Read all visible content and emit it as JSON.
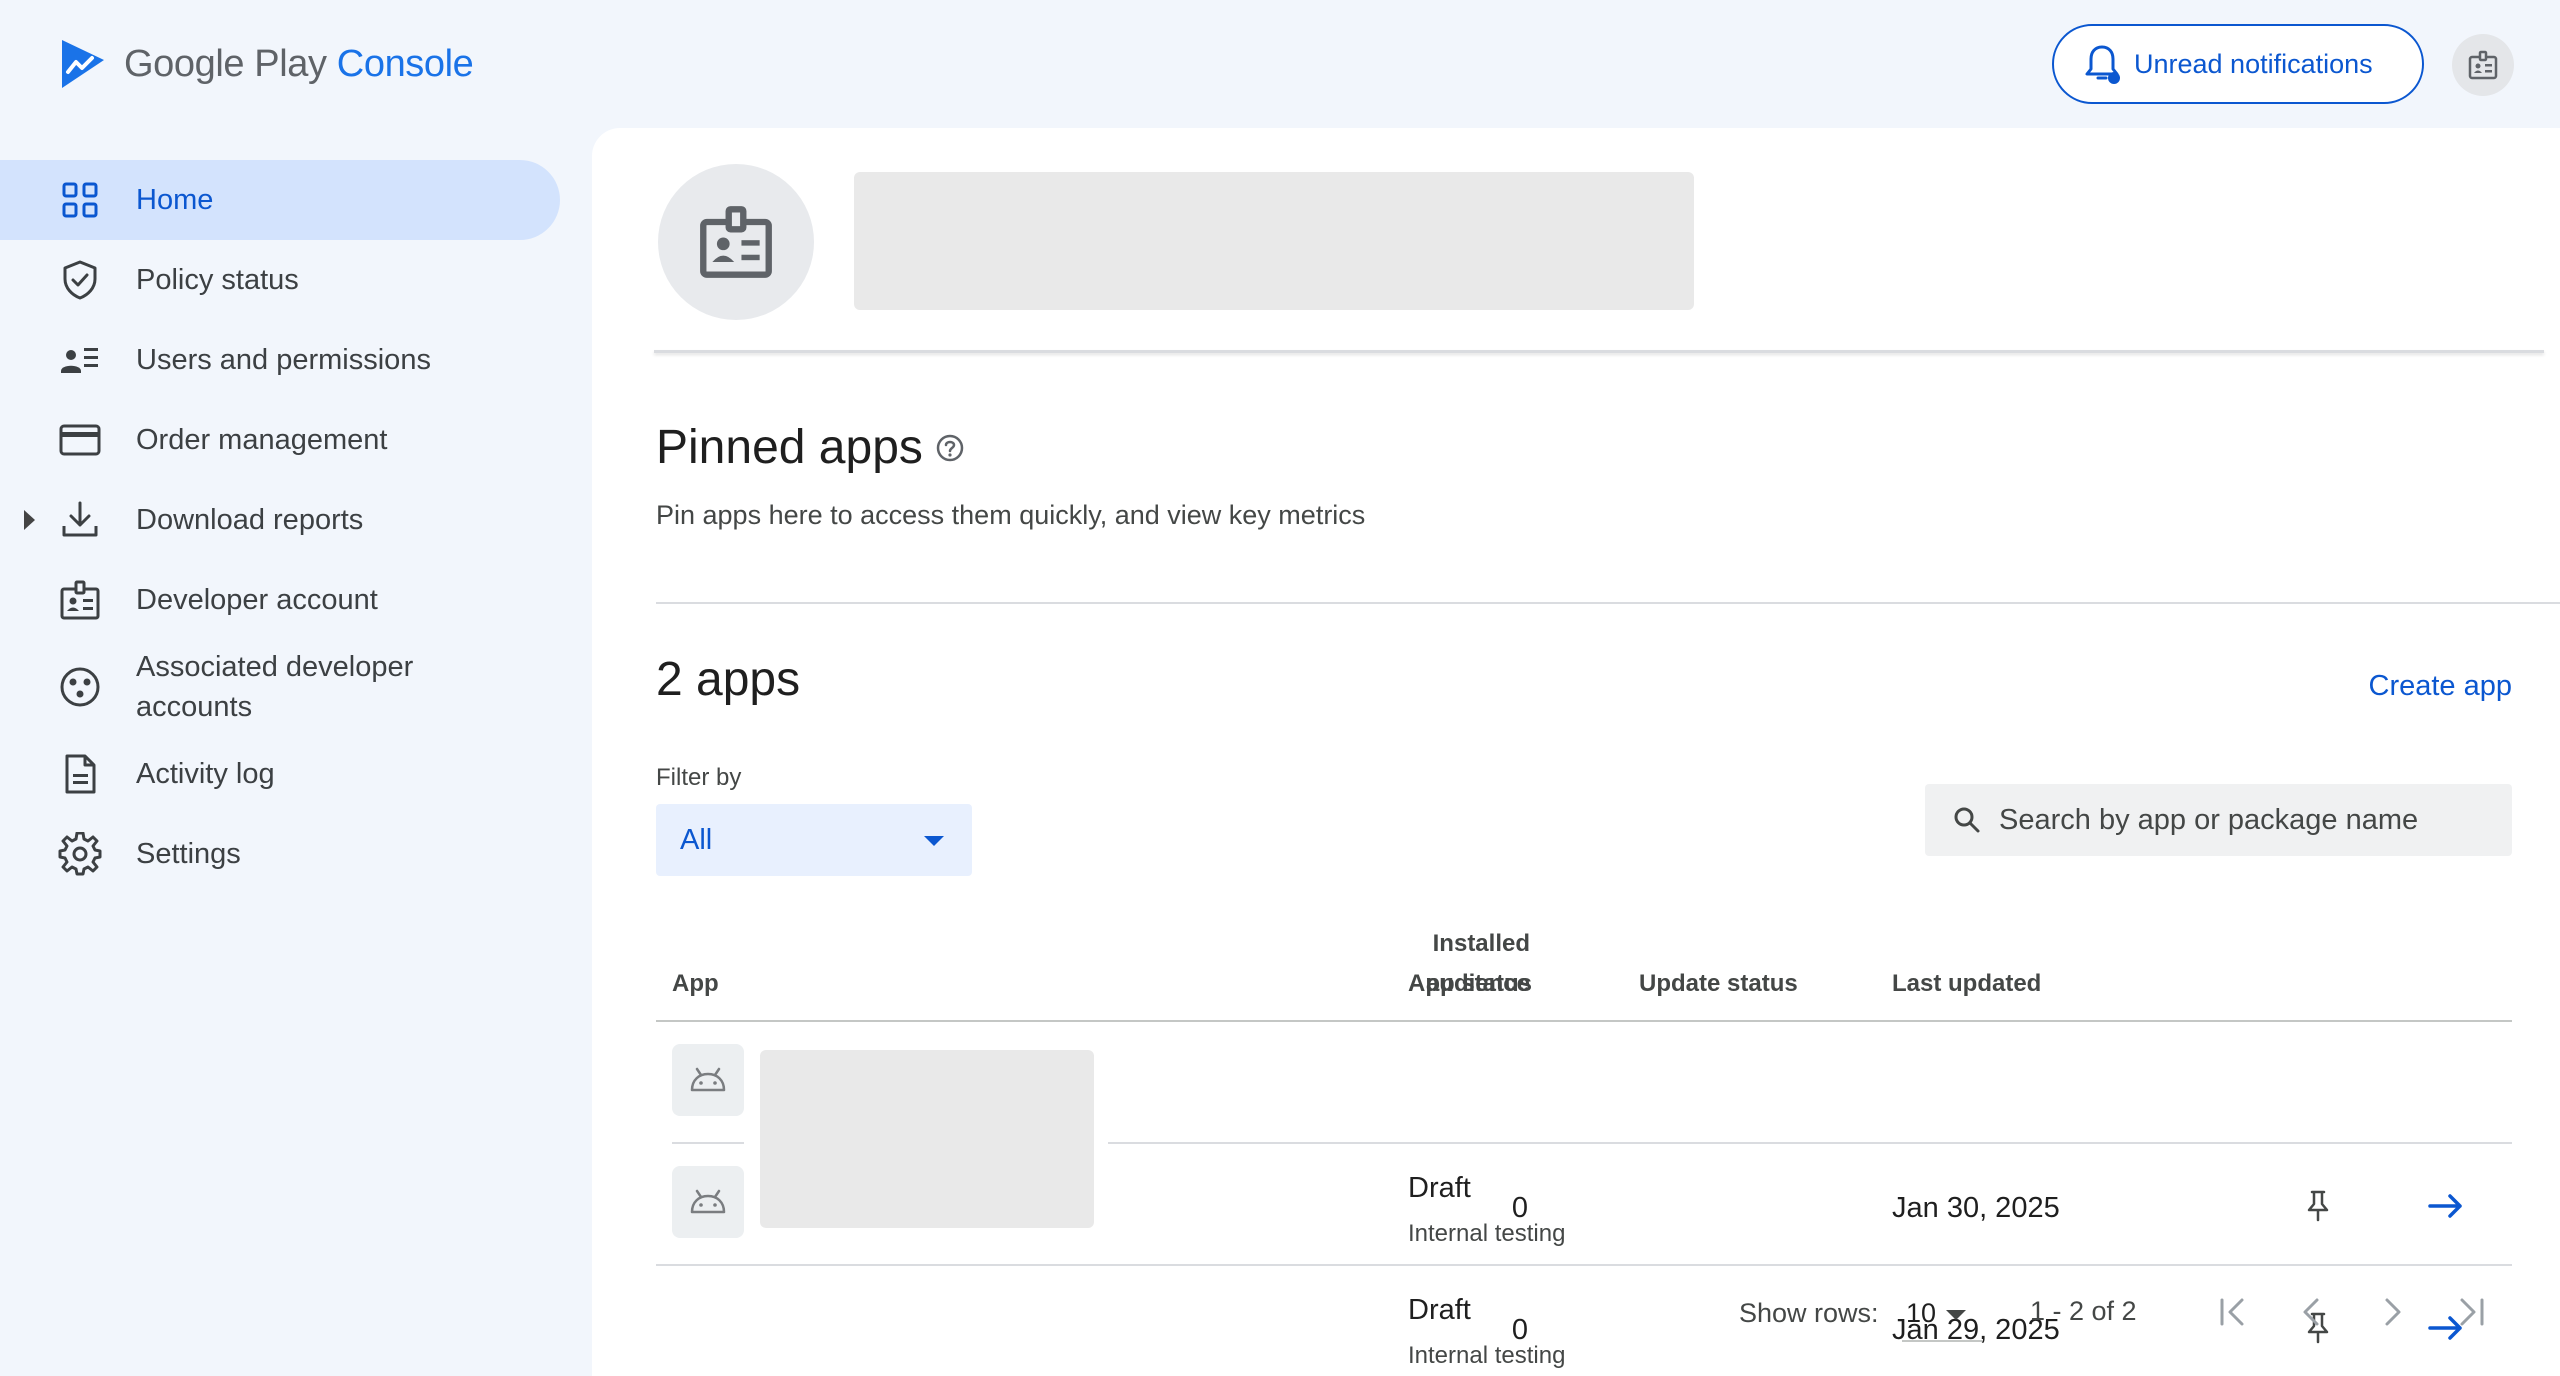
{
  "brand": {
    "name_part1": "Google Play",
    "name_part2": "Console"
  },
  "topbar": {
    "notifications_label": "Unread notifications"
  },
  "sidebar": {
    "items": [
      {
        "label": "Home",
        "icon": "grid-icon",
        "active": true
      },
      {
        "label": "Policy status",
        "icon": "shield-check-icon"
      },
      {
        "label": "Users and permissions",
        "icon": "users-list-icon"
      },
      {
        "label": "Order management",
        "icon": "credit-card-icon"
      },
      {
        "label": "Download reports",
        "icon": "download-icon",
        "expandable": true
      },
      {
        "label": "Developer account",
        "icon": "badge-icon"
      },
      {
        "label": "Associated developer accounts",
        "icon": "linked-accounts-icon"
      },
      {
        "label": "Activity log",
        "icon": "document-icon"
      },
      {
        "label": "Settings",
        "icon": "gear-icon"
      }
    ]
  },
  "pinned": {
    "title": "Pinned apps",
    "description": "Pin apps here to access them quickly, and view key metrics"
  },
  "apps": {
    "count_label": "2 apps",
    "create_label": "Create app",
    "filter_label": "Filter by",
    "filter_value": "All",
    "search_placeholder": "Search by app or package name",
    "columns": {
      "app": "App",
      "installed_line1": "Installed",
      "installed_line2": "audience",
      "app_status": "App status",
      "update_status": "Update status",
      "last_updated": "Last updated"
    },
    "rows": [
      {
        "installed": "0",
        "status": "Draft",
        "track": "Internal testing",
        "update_status": "",
        "last_updated": "Jan 30, 2025"
      },
      {
        "installed": "0",
        "status": "Draft",
        "track": "Internal testing",
        "update_status": "",
        "last_updated": "Jan 29, 2025"
      }
    ]
  },
  "pagination": {
    "show_rows_label": "Show rows:",
    "rows_value": "10",
    "range": "1 - 2 of 2"
  },
  "colors": {
    "accent": "#0b57d0",
    "active_nav_bg": "#d3e3fd",
    "page_bg": "#f2f6fc"
  }
}
